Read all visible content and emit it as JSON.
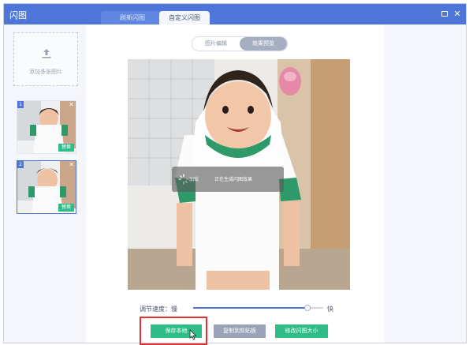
{
  "window": {
    "title": "闪图",
    "tabs": [
      {
        "label": "刷新闪图"
      },
      {
        "label": "自定义闪图"
      }
    ]
  },
  "sidebar": {
    "add_label": "添加多张图片",
    "thumbnails": [
      {
        "number": "1",
        "replace_label": "替换"
      },
      {
        "number": "2",
        "replace_label": "替换"
      }
    ]
  },
  "main": {
    "segmented": [
      "图片编辑",
      "效果预览"
    ],
    "active_segment": "效果预览",
    "loading": {
      "text_left": "加载",
      "text_right": "正在生成闪图效果"
    },
    "speed": {
      "label": "调节速度：慢",
      "fast": "快",
      "value": 0.88
    },
    "buttons": {
      "save": "保存本地",
      "copy": "复制到剪贴板",
      "resize": "修改闪图大小"
    }
  },
  "colors": {
    "titlebar": "#4d76d8",
    "accent_green": "#2ebd89",
    "highlight_red": "#e53030"
  }
}
